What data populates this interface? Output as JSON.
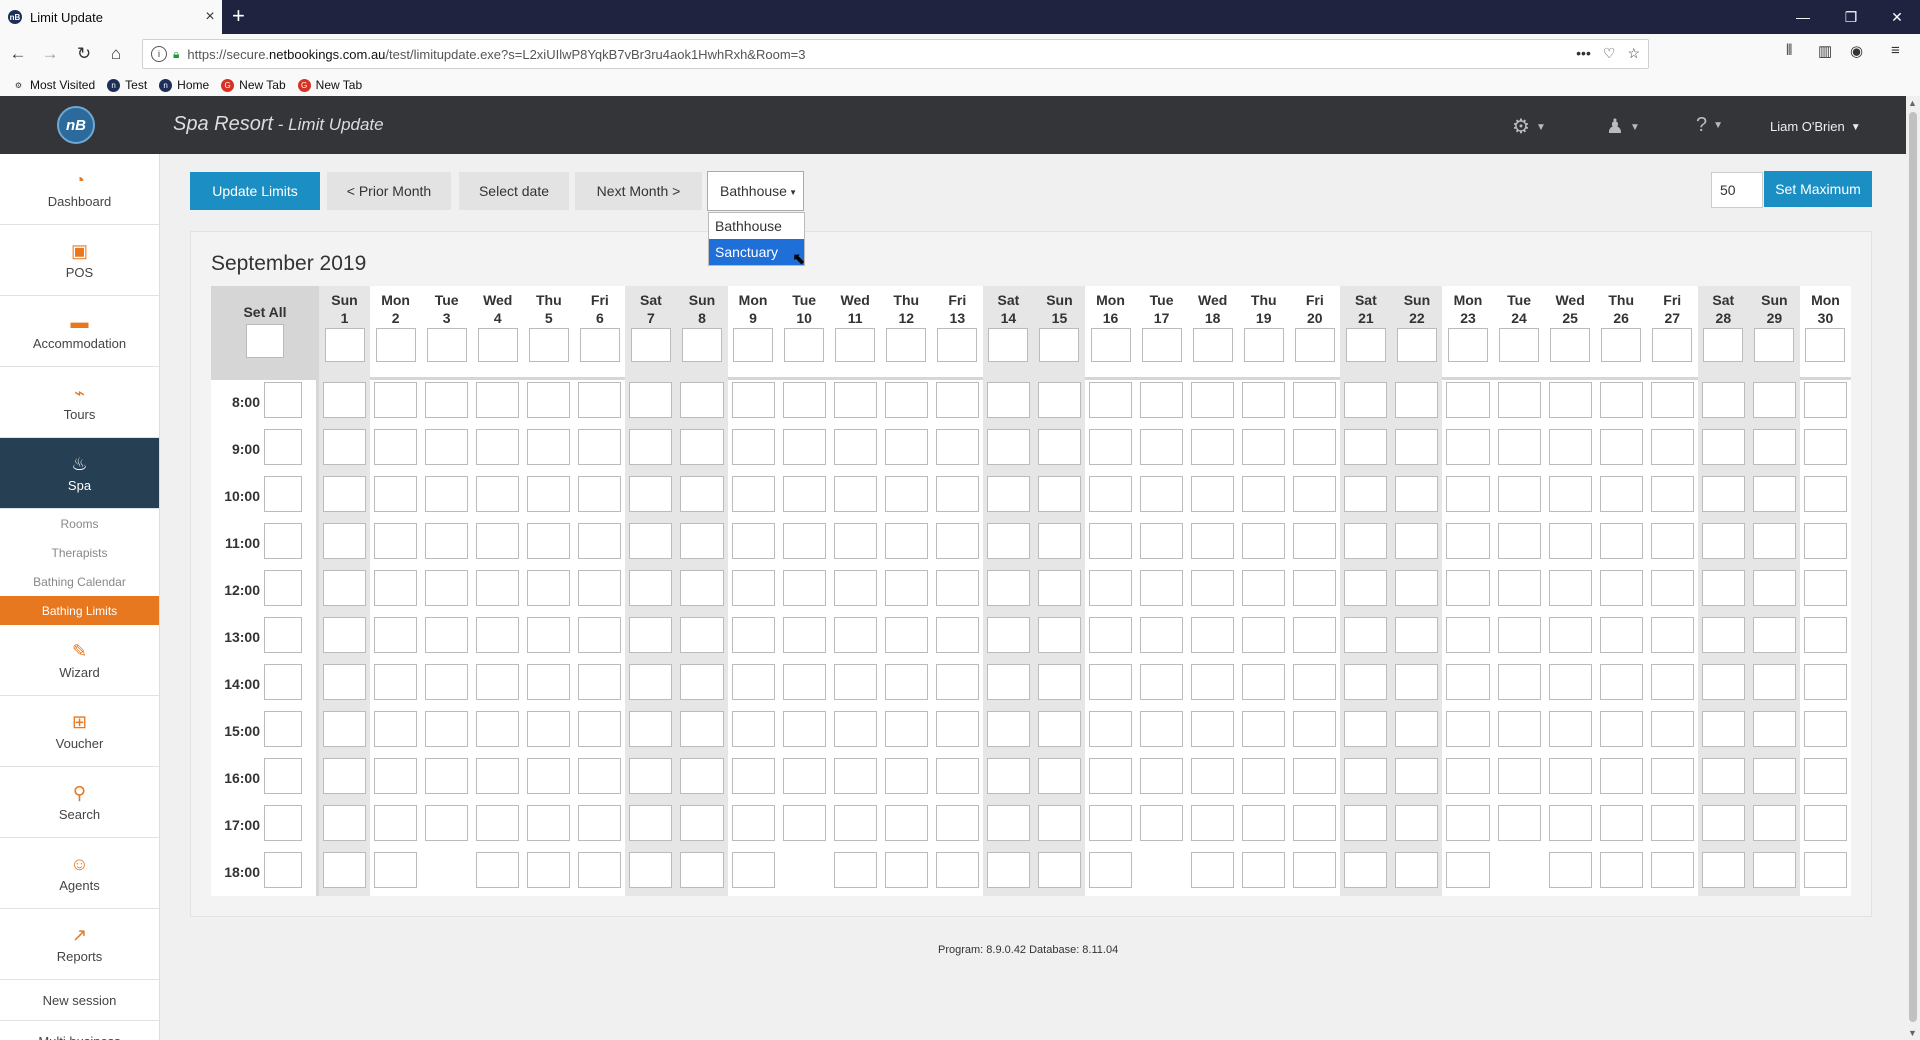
{
  "browser": {
    "tab_title": "Limit Update",
    "url_prefix": "https://secure.",
    "url_domain": "netbookings.com.au",
    "url_rest": "/test/limitupdate.exe?s=L2xiUIlwP8YqkB7vBr3ru4aok1HwhRxh&Room=3",
    "bookmarks": [
      "Most Visited",
      "Test",
      "Home",
      "New Tab",
      "New Tab"
    ]
  },
  "header": {
    "logo_text": "nB",
    "app_name": "Spa Resort",
    "separator": " - ",
    "page_name": "Limit Update",
    "user_name": "Liam O'Brien"
  },
  "sidebar": {
    "items_top": [
      {
        "label": "Dashboard",
        "icon": "dashboard-icon",
        "glyph": "◔"
      },
      {
        "label": "POS",
        "icon": "pos-icon",
        "glyph": "▣"
      },
      {
        "label": "Accommodation",
        "icon": "bed-icon",
        "glyph": "▬"
      },
      {
        "label": "Tours",
        "icon": "tours-icon",
        "glyph": "⌁"
      },
      {
        "label": "Spa",
        "icon": "spa-icon",
        "glyph": "♨"
      }
    ],
    "subitems": [
      "Rooms",
      "Therapists",
      "Bathing Calendar",
      "Bathing Limits"
    ],
    "items_bottom": [
      {
        "label": "Wizard",
        "icon": "wizard-icon",
        "glyph": "✎"
      },
      {
        "label": "Voucher",
        "icon": "gift-icon",
        "glyph": "⊞"
      },
      {
        "label": "Search",
        "icon": "search-icon",
        "glyph": "⚲"
      },
      {
        "label": "Agents",
        "icon": "agents-icon",
        "glyph": "☺"
      },
      {
        "label": "Reports",
        "icon": "reports-icon",
        "glyph": "↗"
      }
    ],
    "new_session": "New session",
    "multi_business": "Multi business"
  },
  "toolbar": {
    "update_limits": "Update Limits",
    "prior_month": "< Prior Month",
    "select_date": "Select date",
    "next_month": "Next Month >",
    "room_selected": "Bathhouse",
    "room_options": [
      "Bathhouse",
      "Sanctuary"
    ],
    "room_highlighted": "Sanctuary",
    "max_value": "50",
    "set_maximum": "Set Maximum"
  },
  "calendar": {
    "month": "September 2019",
    "set_all": "Set All",
    "days": [
      {
        "dow": "Sun",
        "d": "1"
      },
      {
        "dow": "Mon",
        "d": "2"
      },
      {
        "dow": "Tue",
        "d": "3"
      },
      {
        "dow": "Wed",
        "d": "4"
      },
      {
        "dow": "Thu",
        "d": "5"
      },
      {
        "dow": "Fri",
        "d": "6"
      },
      {
        "dow": "Sat",
        "d": "7"
      },
      {
        "dow": "Sun",
        "d": "8"
      },
      {
        "dow": "Mon",
        "d": "9"
      },
      {
        "dow": "Tue",
        "d": "10"
      },
      {
        "dow": "Wed",
        "d": "11"
      },
      {
        "dow": "Thu",
        "d": "12"
      },
      {
        "dow": "Fri",
        "d": "13"
      },
      {
        "dow": "Sat",
        "d": "14"
      },
      {
        "dow": "Sun",
        "d": "15"
      },
      {
        "dow": "Mon",
        "d": "16"
      },
      {
        "dow": "Tue",
        "d": "17"
      },
      {
        "dow": "Wed",
        "d": "18"
      },
      {
        "dow": "Thu",
        "d": "19"
      },
      {
        "dow": "Fri",
        "d": "20"
      },
      {
        "dow": "Sat",
        "d": "21"
      },
      {
        "dow": "Sun",
        "d": "22"
      },
      {
        "dow": "Mon",
        "d": "23"
      },
      {
        "dow": "Tue",
        "d": "24"
      },
      {
        "dow": "Wed",
        "d": "25"
      },
      {
        "dow": "Thu",
        "d": "26"
      },
      {
        "dow": "Fri",
        "d": "27"
      },
      {
        "dow": "Sat",
        "d": "28"
      },
      {
        "dow": "Sun",
        "d": "29"
      },
      {
        "dow": "Mon",
        "d": "30"
      }
    ],
    "times": [
      "8:00",
      "9:00",
      "10:00",
      "11:00",
      "12:00",
      "13:00",
      "14:00",
      "15:00",
      "16:00",
      "17:00",
      "18:00"
    ],
    "missing_18_00_days": [
      "3",
      "10",
      "17",
      "24"
    ]
  },
  "footer": {
    "version": "Program: 8.9.0.42 Database: 8.11.04"
  },
  "colors": {
    "primary_button": "#1b8fc4",
    "sidebar_active": "#273f52",
    "accent_orange": "#e8781f",
    "header_bg": "#333538"
  }
}
